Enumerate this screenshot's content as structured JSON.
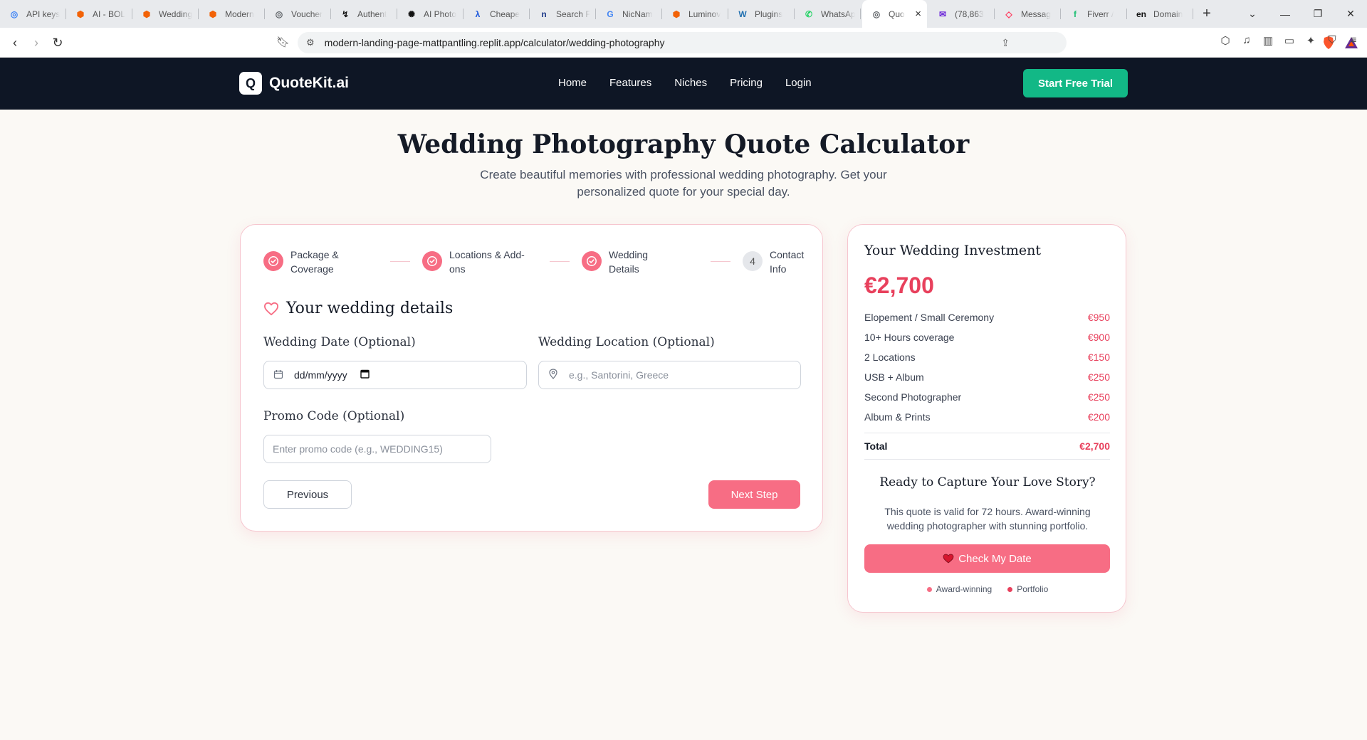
{
  "browser": {
    "tabs": [
      {
        "label": "API keys",
        "icon": "globe-icon",
        "color": "#3b82f6"
      },
      {
        "label": "AI - BOL",
        "icon": "replit-icon",
        "color": "#f26207"
      },
      {
        "label": "Wedding",
        "icon": "replit-icon",
        "color": "#f26207"
      },
      {
        "label": "Modern",
        "icon": "replit-icon",
        "color": "#f26207"
      },
      {
        "label": "Voucher",
        "icon": "globe-icon",
        "color": "#5f6368"
      },
      {
        "label": "Authent",
        "icon": "pulse-icon",
        "color": "#111111"
      },
      {
        "label": "AI Photo",
        "icon": "openai-icon",
        "color": "#111111"
      },
      {
        "label": "Cheape",
        "icon": "lambda-icon",
        "color": "#1a56db"
      },
      {
        "label": "Search F",
        "icon": "n-icon",
        "color": "#1e3a8a"
      },
      {
        "label": "NicNam",
        "icon": "google-icon",
        "color": "#4285f4"
      },
      {
        "label": "Luminov",
        "icon": "replit-icon",
        "color": "#f26207"
      },
      {
        "label": "Plugins",
        "icon": "wordpress-icon",
        "color": "#2271b1"
      },
      {
        "label": "WhatsAp",
        "icon": "whatsapp-icon",
        "color": "#25d366"
      },
      {
        "label": "Quo",
        "icon": "globe-icon",
        "color": "#5f6368",
        "active": true
      },
      {
        "label": "(78,863",
        "icon": "mail-icon",
        "color": "#6d28d9"
      },
      {
        "label": "Messag",
        "icon": "airbnb-icon",
        "color": "#ff385c"
      },
      {
        "label": "Fiverr /",
        "icon": "fiverr-icon",
        "color": "#1dbf73"
      },
      {
        "label": "Domain",
        "icon": "en-icon",
        "color": "#111111"
      }
    ],
    "url": "modern-landing-page-mattpantling.replit.app/calculator/wedding-photography"
  },
  "nav": {
    "logo_letter": "Q",
    "logo_text": "QuoteKit.ai",
    "links": [
      "Home",
      "Features",
      "Niches",
      "Pricing",
      "Login"
    ],
    "cta": "Start Free Trial"
  },
  "hero": {
    "title": "Wedding Photography Quote Calculator",
    "subtitle": "Create beautiful memories with professional wedding photography. Get your personalized quote for your special day."
  },
  "steps": [
    {
      "label": "Package &\nCoverage",
      "status": "done"
    },
    {
      "label": "Locations & Add-\nons",
      "status": "done"
    },
    {
      "label": "Wedding\nDetails",
      "status": "done"
    },
    {
      "label": "Contact\nInfo",
      "status": "todo",
      "number": "4"
    }
  ],
  "form": {
    "section_title": "Your wedding details",
    "date_label": "Wedding Date (Optional)",
    "date_value": "dd/mm/yyyy",
    "location_label": "Wedding Location (Optional)",
    "location_placeholder": "e.g., Santorini, Greece",
    "promo_label": "Promo Code (Optional)",
    "promo_placeholder": "Enter promo code (e.g., WEDDING15)",
    "prev": "Previous",
    "next": "Next Step"
  },
  "summary": {
    "title": "Your Wedding Investment",
    "total_big": "€2,700",
    "items": [
      {
        "label": "Elopement / Small Ceremony",
        "amount": "€950"
      },
      {
        "label": "10+ Hours coverage",
        "amount": "€900"
      },
      {
        "label": "2 Locations",
        "amount": "€150"
      },
      {
        "label": "USB + Album",
        "amount": "€250"
      },
      {
        "label": "Second Photographer",
        "amount": "€250"
      },
      {
        "label": "Album & Prints",
        "amount": "€200"
      }
    ],
    "total_label": "Total",
    "total_value": "€2,700",
    "cta_title": "Ready to Capture Your Love Story?",
    "cta_text": "This quote is valid for 72 hours. Award-winning wedding photographer with stunning portfolio.",
    "cta_button": "Check My Date",
    "badges": [
      "Award-winning",
      "Portfolio"
    ]
  },
  "colors": {
    "brand_dark": "#0e1625",
    "accent_pink": "#f76d84",
    "price_red": "#e8405c",
    "trial_green": "#12b886"
  }
}
